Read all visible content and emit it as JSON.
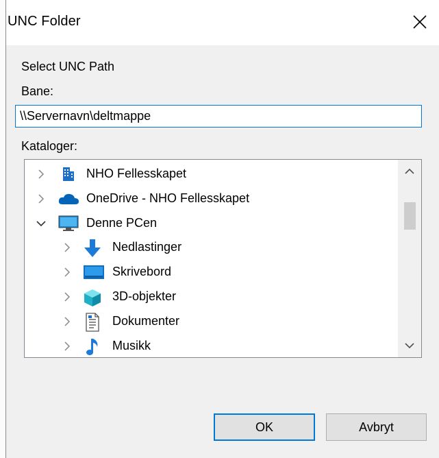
{
  "dialog": {
    "title": "UNC Folder",
    "heading": "Select UNC Path",
    "path_label": "Bane:",
    "path_value": "\\\\Servernavn\\deltmappe",
    "folders_label": "Kataloger:",
    "ok_label": "OK",
    "cancel_label": "Avbryt"
  },
  "tree": {
    "items": [
      {
        "label": "NHO Fellesskapet",
        "icon": "building-icon",
        "expanded": false,
        "level": 0
      },
      {
        "label": "OneDrive - NHO Fellesskapet",
        "icon": "cloud-icon",
        "expanded": false,
        "level": 0
      },
      {
        "label": "Denne PCen",
        "icon": "computer-icon",
        "expanded": true,
        "level": 0
      },
      {
        "label": "Nedlastinger",
        "icon": "download-arrow-icon",
        "expanded": false,
        "level": 1
      },
      {
        "label": "Skrivebord",
        "icon": "desktop-icon",
        "expanded": false,
        "level": 1
      },
      {
        "label": "3D-objekter",
        "icon": "cube-icon",
        "expanded": false,
        "level": 1
      },
      {
        "label": "Dokumenter",
        "icon": "document-icon",
        "expanded": false,
        "level": 1
      },
      {
        "label": "Musikk",
        "icon": "music-note-icon",
        "expanded": false,
        "level": 1
      }
    ]
  },
  "colors": {
    "accent": "#0078d7",
    "onedrive": "#0364b8",
    "download": "#1e7ad8"
  }
}
